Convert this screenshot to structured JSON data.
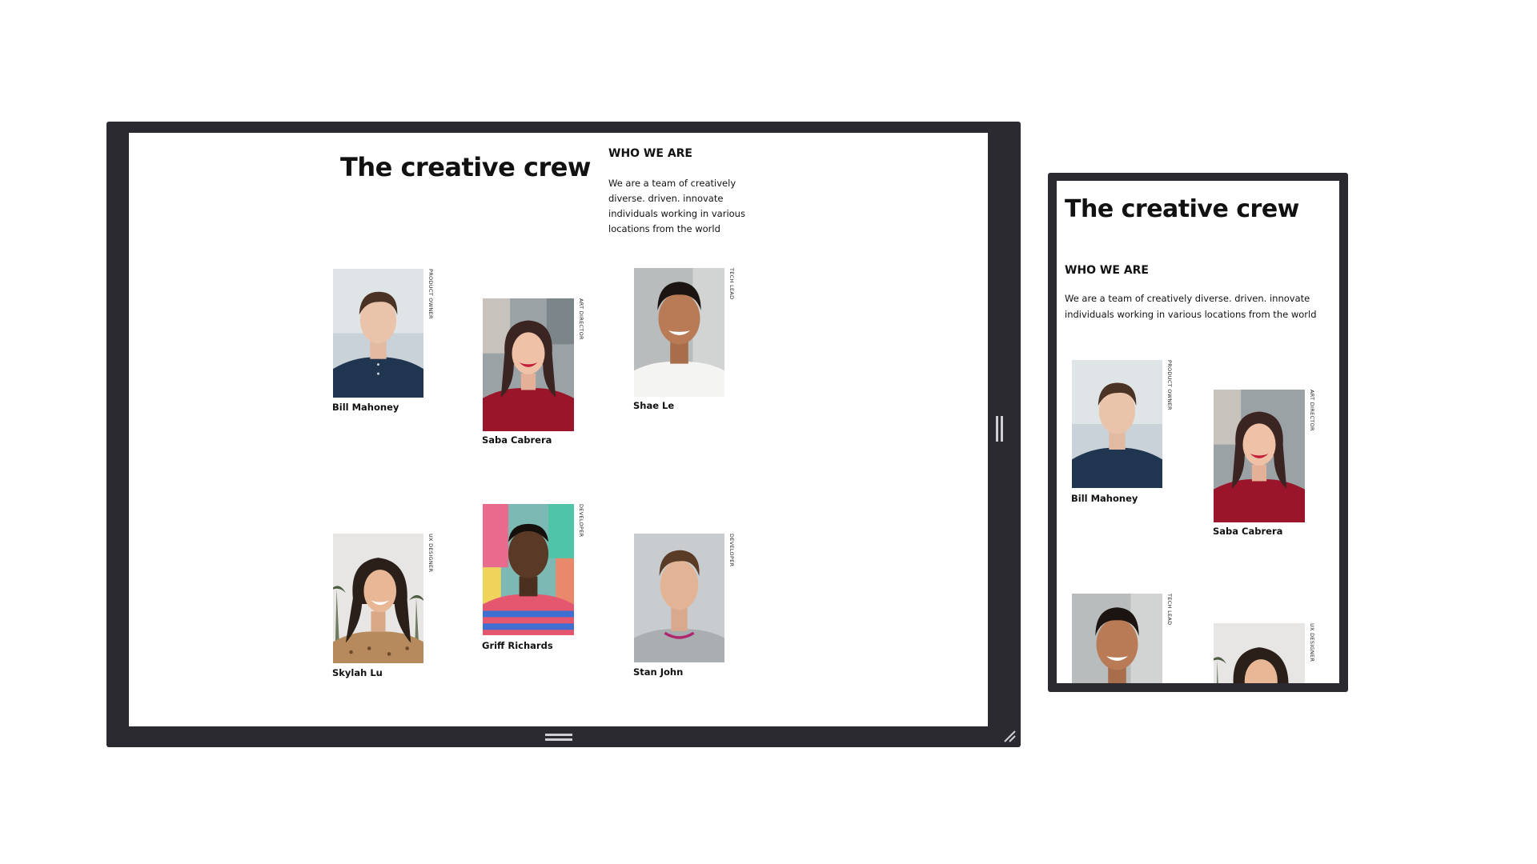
{
  "page": {
    "title": "The creative crew",
    "about_heading": "WHO WE ARE",
    "about_text": "We are a team of creatively diverse. driven. innovate individuals working in various locations from the world"
  },
  "team": [
    {
      "name": "Bill Mahoney",
      "role": "PRODUCT OWNER"
    },
    {
      "name": "Saba Cabrera",
      "role": "ART DIRECTOR"
    },
    {
      "name": "Shae Le",
      "role": "TECH LEAD"
    },
    {
      "name": "Skylah Lu",
      "role": "UX DESIGNER"
    },
    {
      "name": "Griff Richards",
      "role": "DEVELOPER"
    },
    {
      "name": "Stan John",
      "role": "DEVELOPER"
    }
  ],
  "icons": {
    "side_resize": "vertical-resize-handle-icon",
    "bottom_resize": "horizontal-resize-handle-icon",
    "corner_resize": "corner-resize-grip-icon"
  },
  "colors": {
    "frame": "#2b2a30",
    "viewport": "#ffffff",
    "text": "#111111",
    "handle": "#cfcfd4"
  }
}
